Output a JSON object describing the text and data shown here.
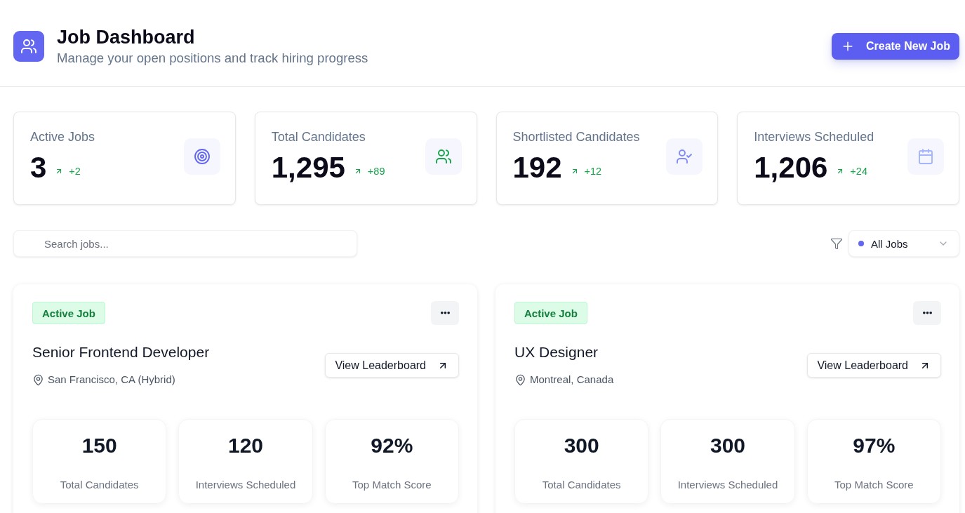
{
  "header": {
    "title": "Job Dashboard",
    "subtitle": "Manage your open positions and track hiring progress",
    "create_button": "Create New Job"
  },
  "stats": [
    {
      "kind": "jobs",
      "label": "Active Jobs",
      "value": "3",
      "change": "+2"
    },
    {
      "kind": "candidates",
      "label": "Total Candidates",
      "value": "1,295",
      "change": "+89"
    },
    {
      "kind": "shortlisted",
      "label": "Shortlisted Candidates",
      "value": "192",
      "change": "+12"
    },
    {
      "kind": "interviews",
      "label": "Interviews Scheduled",
      "value": "1,206",
      "change": "+24"
    }
  ],
  "toolbar": {
    "search": {
      "placeholder": "Search jobs..."
    },
    "job_filter": {
      "value": "All Jobs"
    }
  },
  "jobs": [
    {
      "status": {
        "kind": "active",
        "label": "Active Job"
      },
      "title": "Senior Frontend Developer",
      "location": "San Francisco, CA (Hybrid)",
      "action": "View Leaderboard",
      "metrics": [
        {
          "value": "150",
          "label": "Total Candidates"
        },
        {
          "value": "120",
          "label": "Interviews Scheduled"
        },
        {
          "value": "92%",
          "label": "Top Match Score"
        }
      ]
    },
    {
      "status": {
        "kind": "active",
        "label": "Active Job"
      },
      "title": "UX Designer",
      "location": "Montreal, Canada",
      "action": "View Leaderboard",
      "metrics": [
        {
          "value": "300",
          "label": "Total Candidates"
        },
        {
          "value": "300",
          "label": "Interviews Scheduled"
        },
        {
          "value": "97%",
          "label": "Top Match Score"
        }
      ]
    }
  ]
}
